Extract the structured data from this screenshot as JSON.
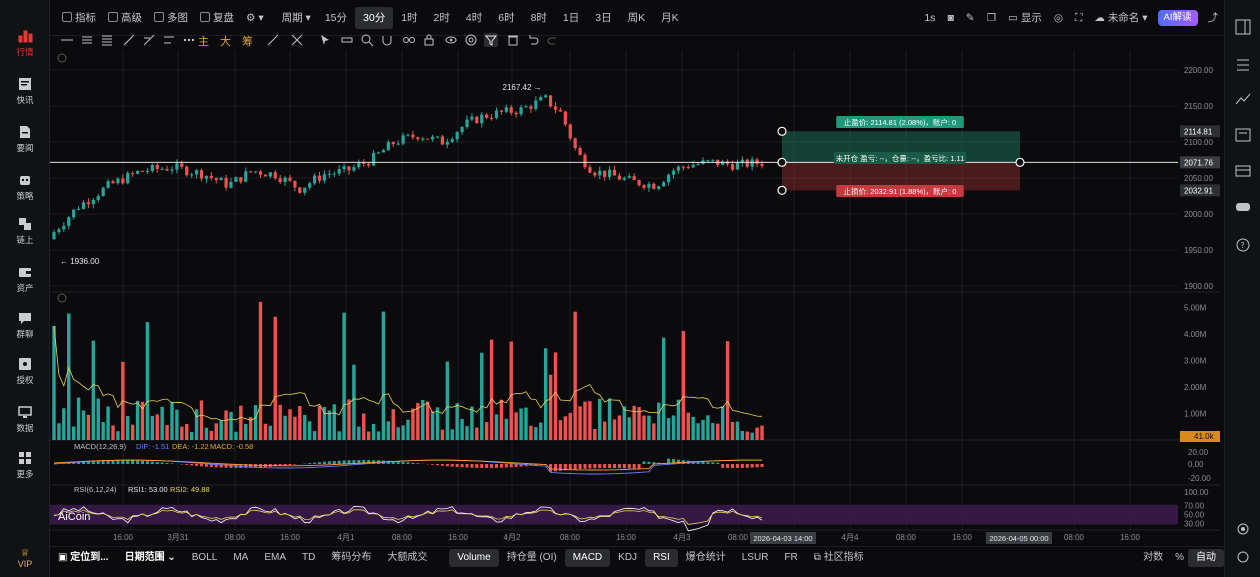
{
  "sidebar": {
    "items": [
      {
        "label": "行情",
        "icon": "bar-chart-icon"
      },
      {
        "label": "快讯",
        "icon": "news-icon"
      },
      {
        "label": "要闻",
        "icon": "document-icon"
      },
      {
        "label": "策略",
        "icon": "robot-icon"
      },
      {
        "label": "链上",
        "icon": "chain-icon"
      },
      {
        "label": "资产",
        "icon": "wallet-icon"
      },
      {
        "label": "群聊",
        "icon": "chat-icon"
      },
      {
        "label": "授权",
        "icon": "key-icon"
      },
      {
        "label": "数据",
        "icon": "monitor-icon"
      },
      {
        "label": "更多",
        "icon": "grid-icon"
      }
    ],
    "vip_label": "VIP"
  },
  "topbar": {
    "indicators_label": "指标",
    "advanced_label": "高级",
    "multi_label": "多图",
    "review_label": "复盘",
    "period_label": "周期",
    "timeframes": [
      "15分",
      "30分",
      "1时",
      "2时",
      "4时",
      "6时",
      "8时",
      "1日",
      "3日",
      "周K",
      "月K"
    ],
    "active_timeframe": "30分",
    "interval_label": "1s",
    "display_label": "显示",
    "layout_name": "未命名",
    "ai_button": "AI解读"
  },
  "drawbar": {
    "main_label": "主",
    "big_label": "大",
    "chip_label": "筹"
  },
  "price_chart": {
    "high_label": "2167.42",
    "low_label": "1936.00",
    "current_price": "2071.76",
    "take_profit_price": "2114.81",
    "stop_loss_price": "2032.91",
    "take_profit_text": "止盈价: 2114.81 (2.08%)，账户: 0",
    "stop_loss_text": "止损价: 2032.91 (1.88%)，账户: 0",
    "open_text": "未开仓 盈亏: --，仓量: --，盈亏比: 1.11",
    "y_ticks": [
      "2200.00",
      "2150.00",
      "2100.00",
      "2050.00",
      "2000.00",
      "1950.00",
      "1900.00"
    ],
    "y_range": [
      1900,
      2200
    ]
  },
  "volume_chart": {
    "y_ticks": [
      "5.00M",
      "4.00M",
      "3.00M",
      "2.00M",
      "1.00M"
    ],
    "current_volume": "41.0k"
  },
  "macd": {
    "title": "MACD(12,26,9)",
    "dif": "DIF: -1.51",
    "dea": "DEA: -1.22",
    "macd": "MACD: -0.58",
    "y_ticks": [
      "20.00",
      "0.00",
      "-20.00"
    ]
  },
  "rsi": {
    "title": "RSI(6,12,24)",
    "rsi1": "RSI1: 53.00",
    "rsi2": "RSI2: 49.88",
    "y_ticks": [
      "100.00",
      "70.00",
      "50.00",
      "30.00"
    ]
  },
  "x_axis": {
    "labels": [
      "16:00",
      "3月31",
      "08:00",
      "16:00",
      "4月1",
      "08:00",
      "16:00",
      "4月2",
      "08:00",
      "16:00",
      "4月3",
      "08:00",
      "16:00",
      "4月4",
      "08:00",
      "16:00",
      "08:00",
      "16:00"
    ],
    "cursor_label": "2026-04-03 14:00",
    "cursor_label2": "2026-04-05 00:00"
  },
  "watermark": "AiCoin",
  "bottombar": {
    "locate_label": "定位到...",
    "date_range_label": "日期范围",
    "indicators": [
      "BOLL",
      "MA",
      "EMA",
      "TD",
      "筹码分布",
      "大额成交"
    ],
    "sub_indicators": [
      "Volume",
      "持仓量 (OI)",
      "MACD",
      "KDJ",
      "RSI",
      "爆仓统计",
      "LSUR",
      "FR"
    ],
    "active_sub": [
      "Volume",
      "MACD",
      "RSI"
    ],
    "community_label": "社区指标",
    "log_label": "对数",
    "percent_label": "%",
    "auto_label": "自动"
  },
  "colors": {
    "up": "#26a69a",
    "down": "#ef5350",
    "bg": "#0b0b0d",
    "grid": "#1c1e22",
    "tp": "#1f6e55",
    "sl": "#7d2a2c",
    "ma": "#e8d45a",
    "price_line": "#ffffff",
    "rsi_band": "#3d1b4e"
  }
}
